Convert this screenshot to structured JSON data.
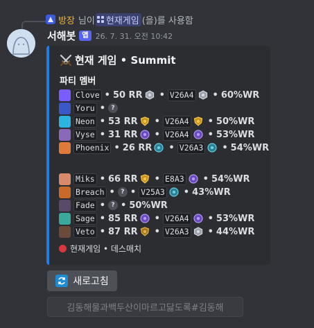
{
  "reply": {
    "role": "방장",
    "connector": "님이",
    "command": "현재게임",
    "suffix": "(을)를 사용함"
  },
  "message": {
    "username": "서해봇",
    "app_tag": "앱",
    "timestamp": "26. 7. 31. 오전 10:42"
  },
  "embed": {
    "accent": "#1f7fe0",
    "title": "현재 게임 • Summit",
    "field_name": "파티 멤버",
    "team1": [
      {
        "name": "Clove",
        "rr": "50 RR",
        "code": "V26A4",
        "wr": "60%WR",
        "rank_a": "silver",
        "rank_b": "silver",
        "agent_color": "#7b5cff"
      },
      {
        "name": "Yoru",
        "rr": null,
        "code": null,
        "wr": null,
        "rank_a": "unknown",
        "rank_b": null,
        "agent_color": "#3a58c9"
      },
      {
        "name": "Neon",
        "rr": "53 RR",
        "code": "V26A4",
        "wr": "50%WR",
        "rank_a": "gold",
        "rank_b": "gold",
        "agent_color": "#2bb4e0"
      },
      {
        "name": "Vyse",
        "rr": "31 RR",
        "code": "V26A4",
        "wr": "53%WR",
        "rank_a": "plat",
        "rank_b": "plat",
        "agent_color": "#8a6ab8"
      },
      {
        "name": "Phoenix",
        "rr": "26 RR",
        "code": "V26A3",
        "wr": "54%WR",
        "rank_a": "diamond",
        "rank_b": "diamond",
        "agent_color": "#e07a3a"
      }
    ],
    "team2": [
      {
        "name": "Miks",
        "rr": "66 RR",
        "code": "E8A3",
        "wr": "54%WR",
        "rank_a": "gold",
        "rank_b": "plat",
        "agent_color": "#d98a6a"
      },
      {
        "name": "Breach",
        "rr": null,
        "code": "V25A3",
        "wr": "43%WR",
        "rank_a": "unknown",
        "rank_b": "diamond",
        "agent_color": "#c86a2a"
      },
      {
        "name": "Fade",
        "rr": null,
        "code": null,
        "wr": "50%WR",
        "rank_a": "unknown",
        "rank_b": null,
        "agent_color": "#5a4a6a"
      },
      {
        "name": "Sage",
        "rr": "85 RR",
        "code": "V26A4",
        "wr": "53%WR",
        "rank_a": "plat",
        "rank_b": "plat",
        "agent_color": "#3aa89a"
      },
      {
        "name": "Veto",
        "rr": "87 RR",
        "code": "V26A3",
        "wr": "44%WR",
        "rank_a": "gold_shield",
        "rank_b": "silver",
        "agent_color": "#6a4a3a"
      }
    ],
    "status": "현재게임 • 데스매치",
    "status_color": "#da373c"
  },
  "buttons": {
    "refresh_label": "새로고침",
    "disabled_label": "김동해물과백두산이마르고닳도록#김동해"
  },
  "icons": {
    "reply_icon": "role-avatar-icon",
    "title_icon": "crossed-swords-icon",
    "refresh_icon": "refresh-arrows-icon"
  }
}
